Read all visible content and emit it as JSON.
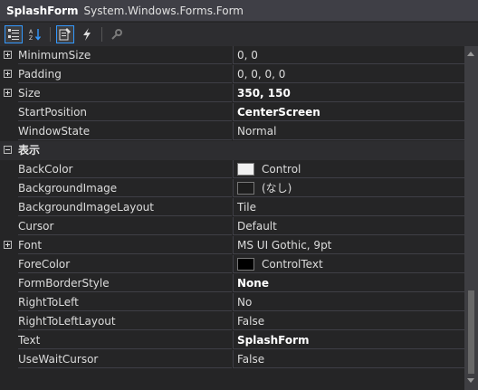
{
  "header": {
    "object_name": "SplashForm",
    "object_type": "System.Windows.Forms.Form"
  },
  "toolbar": {
    "buttons": [
      {
        "icon": "categorized-icon",
        "active": true
      },
      {
        "icon": "alphabetical-icon",
        "active": false
      },
      {
        "icon": "properties-icon",
        "active": true
      },
      {
        "icon": "events-icon",
        "active": false
      },
      {
        "icon": "property-pages-icon",
        "active": false
      }
    ]
  },
  "rows": [
    {
      "type": "prop",
      "name": "MinimumSize",
      "value": "0, 0",
      "expandable": true
    },
    {
      "type": "prop",
      "name": "Padding",
      "value": "0, 0, 0, 0",
      "expandable": true
    },
    {
      "type": "prop",
      "name": "Size",
      "value": "350, 150",
      "expandable": true,
      "bold": true
    },
    {
      "type": "prop",
      "name": "StartPosition",
      "value": "CenterScreen",
      "bold": true
    },
    {
      "type": "prop",
      "name": "WindowState",
      "value": "Normal"
    },
    {
      "type": "category",
      "name": "表示"
    },
    {
      "type": "prop",
      "name": "BackColor",
      "value": "Control",
      "swatch": "#f0f0f0"
    },
    {
      "type": "prop",
      "name": "BackgroundImage",
      "value": "(なし)",
      "swatch": "#1e1e1e"
    },
    {
      "type": "prop",
      "name": "BackgroundImageLayout",
      "value": "Tile"
    },
    {
      "type": "prop",
      "name": "Cursor",
      "value": "Default"
    },
    {
      "type": "prop",
      "name": "Font",
      "value": "MS UI Gothic, 9pt",
      "expandable": true
    },
    {
      "type": "prop",
      "name": "ForeColor",
      "value": "ControlText",
      "swatch": "#000000"
    },
    {
      "type": "prop",
      "name": "FormBorderStyle",
      "value": "None",
      "bold": true
    },
    {
      "type": "prop",
      "name": "RightToLeft",
      "value": "No"
    },
    {
      "type": "prop",
      "name": "RightToLeftLayout",
      "value": "False"
    },
    {
      "type": "prop",
      "name": "Text",
      "value": "SplashForm",
      "bold": true
    },
    {
      "type": "prop",
      "name": "UseWaitCursor",
      "value": "False"
    }
  ]
}
